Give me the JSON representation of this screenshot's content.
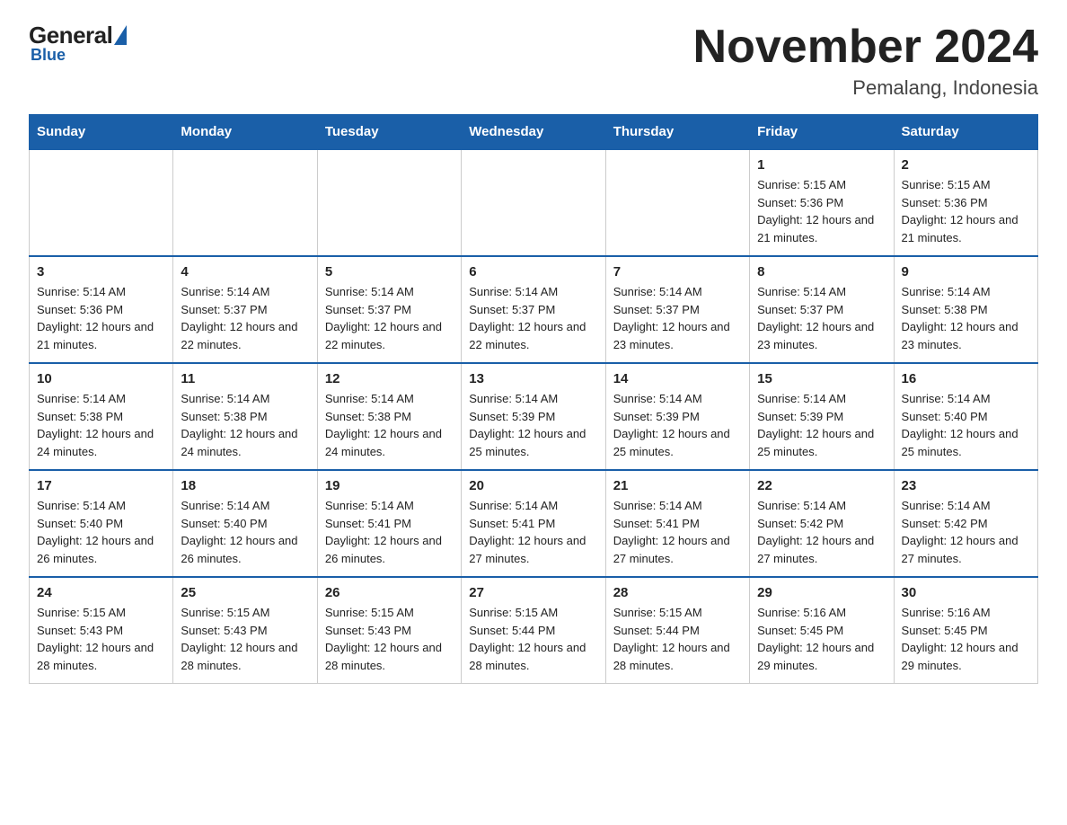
{
  "logo": {
    "general": "General",
    "blue": "Blue",
    "tagline": "Blue"
  },
  "header": {
    "title": "November 2024",
    "subtitle": "Pemalang, Indonesia"
  },
  "days_of_week": [
    "Sunday",
    "Monday",
    "Tuesday",
    "Wednesday",
    "Thursday",
    "Friday",
    "Saturday"
  ],
  "weeks": [
    [
      {
        "day": "",
        "sunrise": "",
        "sunset": "",
        "daylight": "",
        "empty": true
      },
      {
        "day": "",
        "sunrise": "",
        "sunset": "",
        "daylight": "",
        "empty": true
      },
      {
        "day": "",
        "sunrise": "",
        "sunset": "",
        "daylight": "",
        "empty": true
      },
      {
        "day": "",
        "sunrise": "",
        "sunset": "",
        "daylight": "",
        "empty": true
      },
      {
        "day": "",
        "sunrise": "",
        "sunset": "",
        "daylight": "",
        "empty": true
      },
      {
        "day": "1",
        "sunrise": "Sunrise: 5:15 AM",
        "sunset": "Sunset: 5:36 PM",
        "daylight": "Daylight: 12 hours and 21 minutes.",
        "empty": false
      },
      {
        "day": "2",
        "sunrise": "Sunrise: 5:15 AM",
        "sunset": "Sunset: 5:36 PM",
        "daylight": "Daylight: 12 hours and 21 minutes.",
        "empty": false
      }
    ],
    [
      {
        "day": "3",
        "sunrise": "Sunrise: 5:14 AM",
        "sunset": "Sunset: 5:36 PM",
        "daylight": "Daylight: 12 hours and 21 minutes.",
        "empty": false
      },
      {
        "day": "4",
        "sunrise": "Sunrise: 5:14 AM",
        "sunset": "Sunset: 5:37 PM",
        "daylight": "Daylight: 12 hours and 22 minutes.",
        "empty": false
      },
      {
        "day": "5",
        "sunrise": "Sunrise: 5:14 AM",
        "sunset": "Sunset: 5:37 PM",
        "daylight": "Daylight: 12 hours and 22 minutes.",
        "empty": false
      },
      {
        "day": "6",
        "sunrise": "Sunrise: 5:14 AM",
        "sunset": "Sunset: 5:37 PM",
        "daylight": "Daylight: 12 hours and 22 minutes.",
        "empty": false
      },
      {
        "day": "7",
        "sunrise": "Sunrise: 5:14 AM",
        "sunset": "Sunset: 5:37 PM",
        "daylight": "Daylight: 12 hours and 23 minutes.",
        "empty": false
      },
      {
        "day": "8",
        "sunrise": "Sunrise: 5:14 AM",
        "sunset": "Sunset: 5:37 PM",
        "daylight": "Daylight: 12 hours and 23 minutes.",
        "empty": false
      },
      {
        "day": "9",
        "sunrise": "Sunrise: 5:14 AM",
        "sunset": "Sunset: 5:38 PM",
        "daylight": "Daylight: 12 hours and 23 minutes.",
        "empty": false
      }
    ],
    [
      {
        "day": "10",
        "sunrise": "Sunrise: 5:14 AM",
        "sunset": "Sunset: 5:38 PM",
        "daylight": "Daylight: 12 hours and 24 minutes.",
        "empty": false
      },
      {
        "day": "11",
        "sunrise": "Sunrise: 5:14 AM",
        "sunset": "Sunset: 5:38 PM",
        "daylight": "Daylight: 12 hours and 24 minutes.",
        "empty": false
      },
      {
        "day": "12",
        "sunrise": "Sunrise: 5:14 AM",
        "sunset": "Sunset: 5:38 PM",
        "daylight": "Daylight: 12 hours and 24 minutes.",
        "empty": false
      },
      {
        "day": "13",
        "sunrise": "Sunrise: 5:14 AM",
        "sunset": "Sunset: 5:39 PM",
        "daylight": "Daylight: 12 hours and 25 minutes.",
        "empty": false
      },
      {
        "day": "14",
        "sunrise": "Sunrise: 5:14 AM",
        "sunset": "Sunset: 5:39 PM",
        "daylight": "Daylight: 12 hours and 25 minutes.",
        "empty": false
      },
      {
        "day": "15",
        "sunrise": "Sunrise: 5:14 AM",
        "sunset": "Sunset: 5:39 PM",
        "daylight": "Daylight: 12 hours and 25 minutes.",
        "empty": false
      },
      {
        "day": "16",
        "sunrise": "Sunrise: 5:14 AM",
        "sunset": "Sunset: 5:40 PM",
        "daylight": "Daylight: 12 hours and 25 minutes.",
        "empty": false
      }
    ],
    [
      {
        "day": "17",
        "sunrise": "Sunrise: 5:14 AM",
        "sunset": "Sunset: 5:40 PM",
        "daylight": "Daylight: 12 hours and 26 minutes.",
        "empty": false
      },
      {
        "day": "18",
        "sunrise": "Sunrise: 5:14 AM",
        "sunset": "Sunset: 5:40 PM",
        "daylight": "Daylight: 12 hours and 26 minutes.",
        "empty": false
      },
      {
        "day": "19",
        "sunrise": "Sunrise: 5:14 AM",
        "sunset": "Sunset: 5:41 PM",
        "daylight": "Daylight: 12 hours and 26 minutes.",
        "empty": false
      },
      {
        "day": "20",
        "sunrise": "Sunrise: 5:14 AM",
        "sunset": "Sunset: 5:41 PM",
        "daylight": "Daylight: 12 hours and 27 minutes.",
        "empty": false
      },
      {
        "day": "21",
        "sunrise": "Sunrise: 5:14 AM",
        "sunset": "Sunset: 5:41 PM",
        "daylight": "Daylight: 12 hours and 27 minutes.",
        "empty": false
      },
      {
        "day": "22",
        "sunrise": "Sunrise: 5:14 AM",
        "sunset": "Sunset: 5:42 PM",
        "daylight": "Daylight: 12 hours and 27 minutes.",
        "empty": false
      },
      {
        "day": "23",
        "sunrise": "Sunrise: 5:14 AM",
        "sunset": "Sunset: 5:42 PM",
        "daylight": "Daylight: 12 hours and 27 minutes.",
        "empty": false
      }
    ],
    [
      {
        "day": "24",
        "sunrise": "Sunrise: 5:15 AM",
        "sunset": "Sunset: 5:43 PM",
        "daylight": "Daylight: 12 hours and 28 minutes.",
        "empty": false
      },
      {
        "day": "25",
        "sunrise": "Sunrise: 5:15 AM",
        "sunset": "Sunset: 5:43 PM",
        "daylight": "Daylight: 12 hours and 28 minutes.",
        "empty": false
      },
      {
        "day": "26",
        "sunrise": "Sunrise: 5:15 AM",
        "sunset": "Sunset: 5:43 PM",
        "daylight": "Daylight: 12 hours and 28 minutes.",
        "empty": false
      },
      {
        "day": "27",
        "sunrise": "Sunrise: 5:15 AM",
        "sunset": "Sunset: 5:44 PM",
        "daylight": "Daylight: 12 hours and 28 minutes.",
        "empty": false
      },
      {
        "day": "28",
        "sunrise": "Sunrise: 5:15 AM",
        "sunset": "Sunset: 5:44 PM",
        "daylight": "Daylight: 12 hours and 28 minutes.",
        "empty": false
      },
      {
        "day": "29",
        "sunrise": "Sunrise: 5:16 AM",
        "sunset": "Sunset: 5:45 PM",
        "daylight": "Daylight: 12 hours and 29 minutes.",
        "empty": false
      },
      {
        "day": "30",
        "sunrise": "Sunrise: 5:16 AM",
        "sunset": "Sunset: 5:45 PM",
        "daylight": "Daylight: 12 hours and 29 minutes.",
        "empty": false
      }
    ]
  ]
}
